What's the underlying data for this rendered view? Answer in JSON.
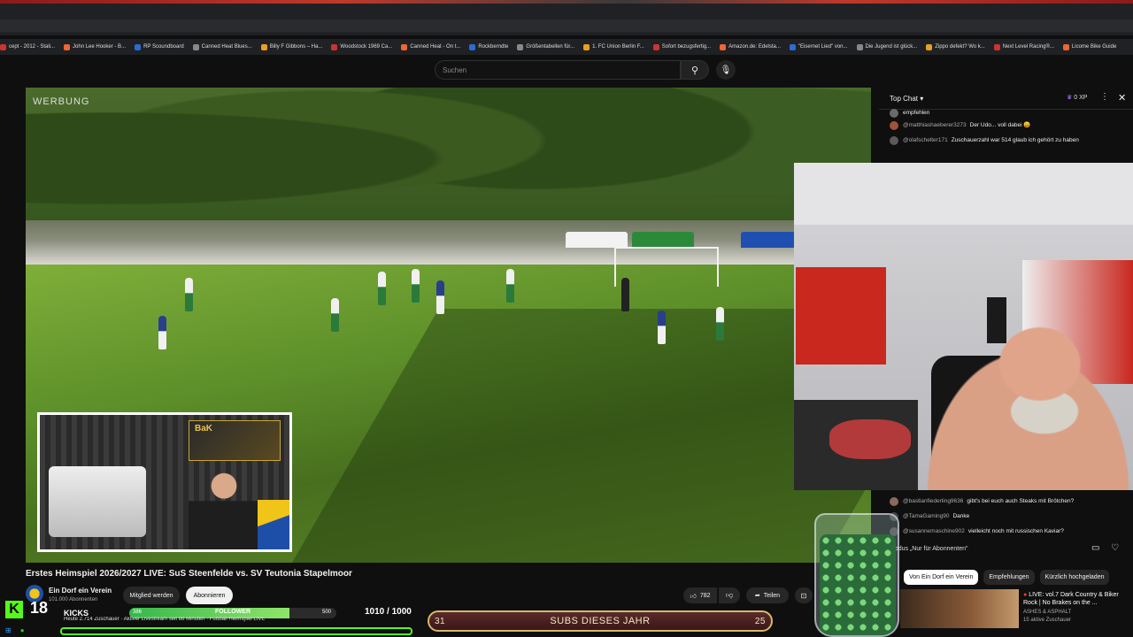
{
  "browser": {
    "bookmarks": [
      "cept - 2012 - Stali...",
      "John Lee Hooker - B...",
      "RP Scoundboard",
      "Canned Heat Blues...",
      "Billy F Gibbons – Ha...",
      "Woodstock 1969 Ca...",
      "Canned Heat - On t...",
      "Rockberndte",
      "Größentabellen für...",
      "1. FC Union Berlin F...",
      "Sofort bezugsfertig...",
      "Amazon.de: Edelsta...",
      "\"Eisernet Lied\" von...",
      "Die Jugend ist glück...",
      "Zippo defekt? Wo k...",
      "Next Level Racing®...",
      "Licome Bike Guide"
    ]
  },
  "header": {
    "search_placeholder": "Suchen"
  },
  "video": {
    "ad_label": "WERBUNG",
    "title": "Erstes Heimspiel 2026/2027 LIVE: SuS Steenfelde vs. SV Teutonia Stapelmoor",
    "pip_banner": "BaK",
    "channel_name": "Ein Dorf ein Verein",
    "subscribers": "101.000 Abonnenten",
    "join_label": "Mitglied werden",
    "subscribe_label": "Abonnieren",
    "likes": "782",
    "share_label": "Teilen"
  },
  "chat": {
    "header_label": "Top Chat",
    "xp": "0 XP",
    "messages": [
      {
        "author": "",
        "text": "empfehlen"
      },
      {
        "author": "@matthiashaeberer3273",
        "text": "Der Udo... voll dabei 😄"
      },
      {
        "author": "@olafschelter171",
        "text": "Zuschauerzahl war 514 glaub ich gehört zu haben"
      },
      {
        "author": "@bastianfiederling9636",
        "text": "gibt's bei euch auch Steaks mit Brötchen?"
      },
      {
        "author": "@TamaGaming90",
        "text": "Danke"
      },
      {
        "author": "@susannemaschine902",
        "text": "vielleicht noch mit russischen Kaviar?"
      }
    ],
    "mode": "Modus „Nur für Abonnenten\"",
    "tabs": [
      "Von Ein Dorf ein Verein",
      "Empfehlungen",
      "Kürzlich hochgeladen"
    ],
    "recommendation": {
      "title": "LIVE: vol.7 Dark Country & Biker Rock | No Brakes on the ...",
      "channel": "ASHES & ASPHALT",
      "watchers": "15 aktive Zuschauer"
    }
  },
  "overlay": {
    "kicks_count": "18",
    "kicks_label": "KICKS",
    "follower_label": "FOLLOWER",
    "follower_current": "386",
    "follower_goal": "500",
    "follower_progress": 0.772,
    "goal_count": "1010 / 1000",
    "subs_label": "SUBS DIESES JAHR",
    "subs_left": "31",
    "subs_right": "25",
    "ticker": "Heute 2.714 Zuschauer · Aktiver Livestream seit 88 Minuten · Fußball Heimspiel LIVE"
  },
  "colors": {
    "kick_green": "#53fc18",
    "subs_border": "#d9b86a",
    "background": "#0f0f0f"
  }
}
